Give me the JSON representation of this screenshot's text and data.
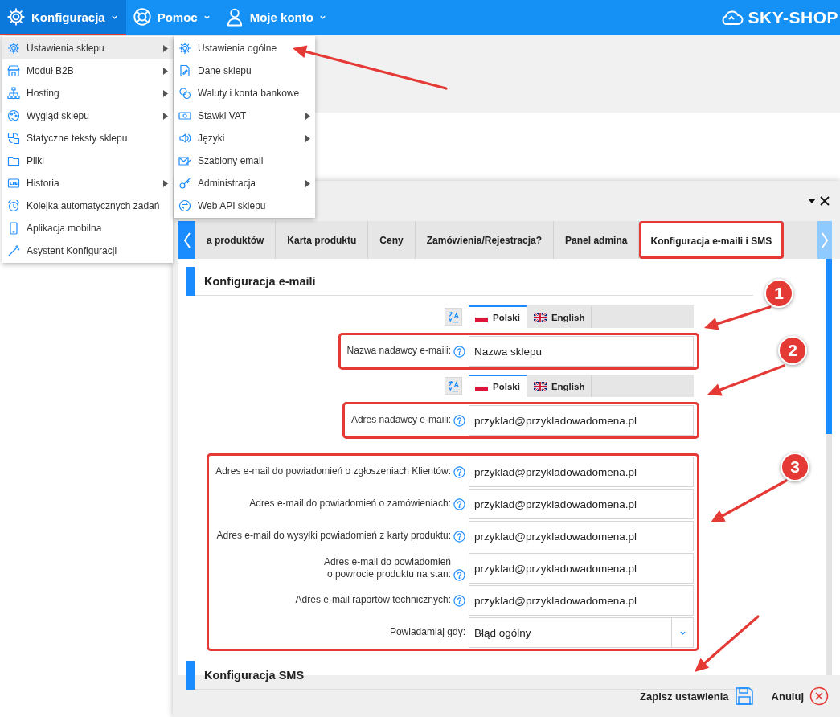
{
  "top_nav": {
    "items": [
      {
        "label": "Konfiguracja",
        "selected": true
      },
      {
        "label": "Pomoc",
        "selected": false
      },
      {
        "label": "Moje konto",
        "selected": false
      }
    ],
    "logo": "SKY-SHOP"
  },
  "menu": {
    "items": [
      {
        "label": "Ustawienia sklepu",
        "selected": true,
        "has_submenu": true
      },
      {
        "label": "Moduł B2B",
        "selected": false,
        "has_submenu": true
      },
      {
        "label": "Hosting",
        "selected": false,
        "has_submenu": true
      },
      {
        "label": "Wygląd sklepu",
        "selected": false,
        "has_submenu": true
      },
      {
        "label": "Statyczne teksty sklepu",
        "selected": false,
        "has_submenu": false
      },
      {
        "label": "Pliki",
        "selected": false,
        "has_submenu": false
      },
      {
        "label": "Historia",
        "selected": false,
        "has_submenu": true
      },
      {
        "label": "Kolejka automatycznych zadań",
        "selected": false,
        "has_submenu": false
      },
      {
        "label": "Aplikacja mobilna",
        "selected": false,
        "has_submenu": false
      },
      {
        "label": "Asystent Konfiguracji",
        "selected": false,
        "has_submenu": false
      }
    ]
  },
  "submenu": {
    "items": [
      {
        "label": "Ustawienia ogólne",
        "selected": false,
        "has_submenu": false
      },
      {
        "label": "Dane sklepu",
        "selected": false,
        "has_submenu": false
      },
      {
        "label": "Waluty i konta bankowe",
        "selected": false,
        "has_submenu": false
      },
      {
        "label": "Stawki VAT",
        "selected": false,
        "has_submenu": true
      },
      {
        "label": "Języki",
        "selected": false,
        "has_submenu": true
      },
      {
        "label": "Szablony email",
        "selected": false,
        "has_submenu": false
      },
      {
        "label": "Administracja",
        "selected": false,
        "has_submenu": true
      },
      {
        "label": "Web API sklepu",
        "selected": false,
        "has_submenu": false
      }
    ]
  },
  "dialog": {
    "tabs": [
      {
        "label": "a produktów",
        "selected": false,
        "highlighted": false
      },
      {
        "label": "Karta produktu",
        "selected": false,
        "highlighted": false
      },
      {
        "label": "Ceny",
        "selected": false,
        "highlighted": false
      },
      {
        "label": "Zamówienia/Rejestracja?",
        "selected": false,
        "highlighted": false
      },
      {
        "label": "Panel admina",
        "selected": false,
        "highlighted": false
      },
      {
        "label": "Konfiguracja e-maili i SMS",
        "selected": true,
        "highlighted": true
      }
    ],
    "section": {
      "heading": "Konfiguracja e-maili",
      "groups": [
        {
          "highlighted": false,
          "rows": [
            {
              "kind": "lang_tabs",
              "tabs": [
                {
                  "label": "Polski",
                  "selected": true
                },
                {
                  "label": "English",
                  "selected": false
                }
              ]
            }
          ]
        },
        {
          "highlighted": true,
          "rows": [
            {
              "kind": "input",
              "label": "Nazwa nadawcy e-maili:",
              "help": true,
              "value": "Nazwa sklepu"
            }
          ]
        },
        {
          "highlighted": false,
          "rows": [
            {
              "kind": "lang_tabs",
              "tabs": [
                {
                  "label": "Polski",
                  "selected": true
                },
                {
                  "label": "English",
                  "selected": false
                }
              ]
            }
          ]
        },
        {
          "highlighted": true,
          "rows": [
            {
              "kind": "input",
              "label": "Adres nadawcy e-maili:",
              "help": true,
              "value": "przyklad@przykladowadomena.pl"
            }
          ]
        },
        {
          "highlighted": true,
          "rows": [
            {
              "kind": "input",
              "label": "Adres e-mail do powiadomień o zgłoszeniach Klientów:",
              "help": true,
              "value": "przyklad@przykladowadomena.pl"
            },
            {
              "kind": "input",
              "label": "Adres e-mail do powiadomień o zamówieniach:",
              "help": true,
              "value": "przyklad@przykladowadomena.pl"
            },
            {
              "kind": "input",
              "label": "Adres e-mail do wysyłki powiadomień z karty produktu:",
              "help": true,
              "value": "przyklad@przykladowadomena.pl"
            },
            {
              "kind": "input",
              "label": "Adres e-mail do powiadomień\no powrocie produktu na stan:",
              "help": true,
              "value": "przyklad@przykladowadomena.pl"
            },
            {
              "kind": "input",
              "label": "Adres e-mail raportów technicznych:",
              "help": true,
              "value": "przyklad@przykladowadomena.pl"
            },
            {
              "kind": "select",
              "label": "Powiadamiaj gdy:",
              "help": false,
              "value": "Błąd ogólny"
            }
          ]
        }
      ]
    },
    "next_section": {
      "heading": "Konfiguracja SMS"
    },
    "buttons": [
      {
        "label": "Zapisz ustawienia",
        "kind": "save"
      },
      {
        "label": "Anuluj",
        "kind": "cancel"
      }
    ]
  },
  "annotations": {
    "badges": [
      "1",
      "2",
      "3"
    ]
  }
}
